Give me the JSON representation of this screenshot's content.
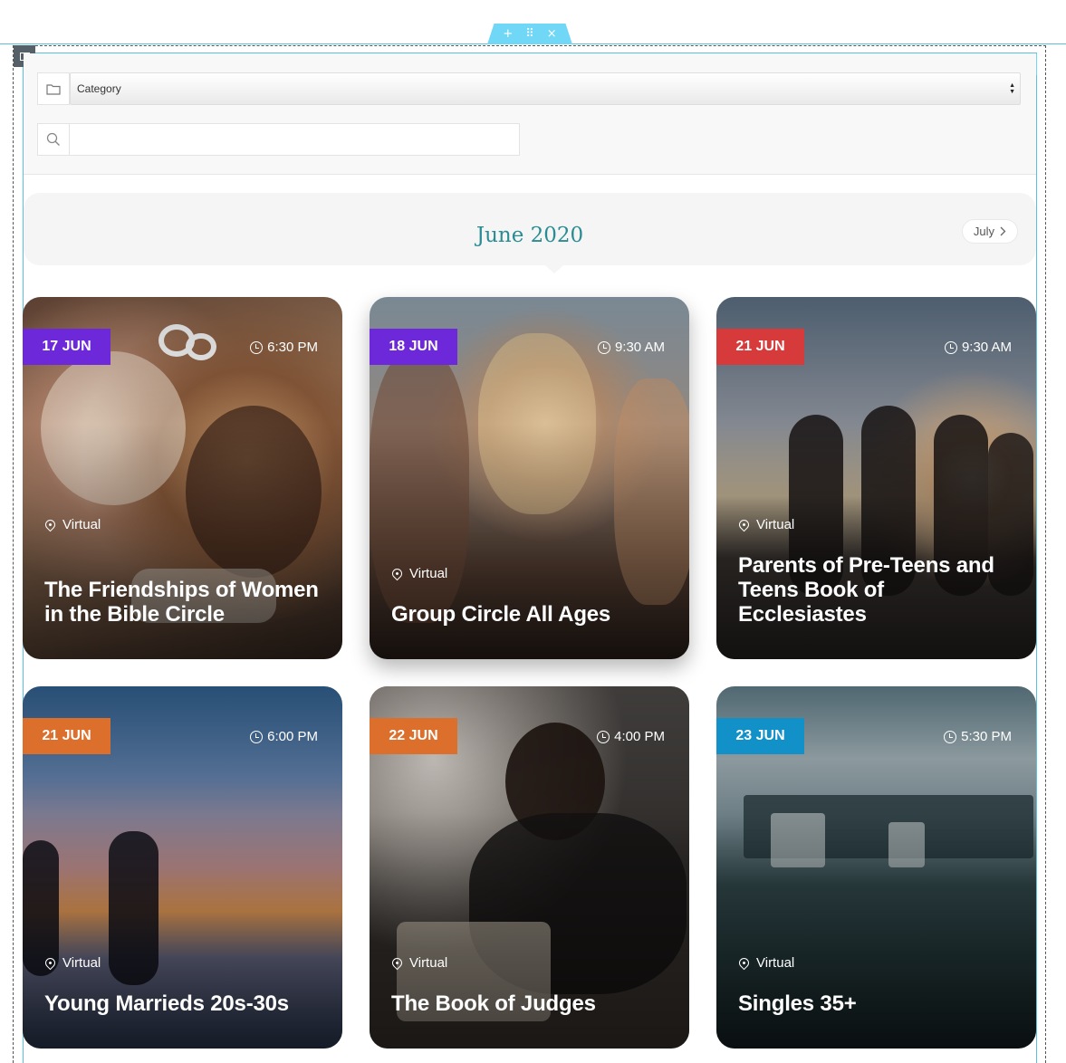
{
  "editor": {
    "handle_add": "+",
    "handle_move": "⠿",
    "handle_close": "×"
  },
  "filters": {
    "category_label": "Category",
    "search_value": "",
    "search_placeholder": ""
  },
  "calendar": {
    "month_title": "June 2020",
    "next_label": "July"
  },
  "events": [
    {
      "date": "17 JUN",
      "time": "6:30 PM",
      "location": "Virtual",
      "title": "The Friendships of Women in the Bible Circle",
      "badge_color": "#6d28d9",
      "image": "friends-laughing-photo"
    },
    {
      "date": "18 JUN",
      "time": "9:30 AM",
      "location": "Virtual",
      "title": "Group Circle All Ages",
      "badge_color": "#6d28d9",
      "image": "women-smiling-photo"
    },
    {
      "date": "21 JUN",
      "time": "9:30 AM",
      "location": "Virtual",
      "title": "Parents of Pre-Teens and Teens Book of Ecclesiastes",
      "badge_color": "#d63a3a",
      "image": "group-sunset-photo"
    },
    {
      "date": "21 JUN",
      "time": "6:00 PM",
      "location": "Virtual",
      "title": "Young Marrieds 20s-30s",
      "badge_color": "#dd6f2c",
      "image": "couple-beach-photo"
    },
    {
      "date": "22 JUN",
      "time": "4:00 PM",
      "location": "Virtual",
      "title": "The Book of Judges",
      "badge_color": "#dd6f2c",
      "image": "man-reading-bible-photo"
    },
    {
      "date": "23 JUN",
      "time": "5:30 PM",
      "location": "Virtual",
      "title": "Singles 35+",
      "badge_color": "#1290c8",
      "image": "city-lake-photo"
    }
  ]
}
